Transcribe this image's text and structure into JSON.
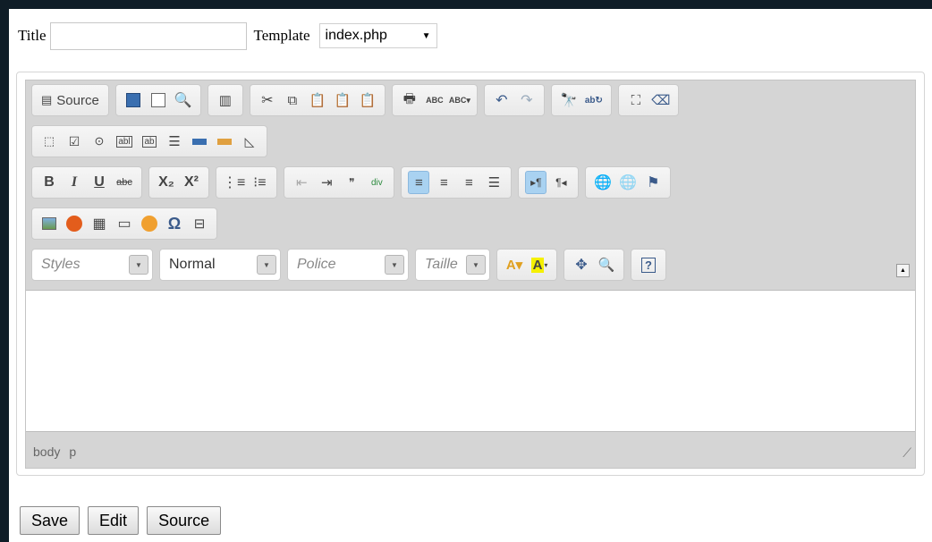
{
  "form": {
    "title_label": "Title",
    "title_value": "",
    "template_label": "Template",
    "template_selected": "index.php"
  },
  "toolbar": {
    "source_label": "Source",
    "row1_icons": [
      "source-icon",
      "save-icon",
      "new-page-icon",
      "preview-icon",
      "templates-icon",
      "cut-icon",
      "copy-icon",
      "paste-icon",
      "paste-text-icon",
      "paste-word-icon",
      "print-icon",
      "spellcheck-icon",
      "spellcheck-as-you-type-icon",
      "undo-icon",
      "redo-icon",
      "find-icon",
      "replace-icon",
      "select-all-icon",
      "remove-format-icon"
    ],
    "row2_icons": [
      "form-icon",
      "checkbox-icon",
      "radio-icon",
      "textfield-icon",
      "textarea-icon",
      "select-icon",
      "button-icon",
      "image-button-icon",
      "hidden-field-icon"
    ],
    "text_glyphs": {
      "bold": "B",
      "italic": "I",
      "underline": "U",
      "strike": "abc",
      "subscript": "X₂",
      "superscript": "X²",
      "quote": "❞"
    },
    "combos": {
      "styles": "Styles",
      "format": "Normal",
      "font": "Police",
      "size": "Taillе"
    }
  },
  "status": {
    "path": [
      "body",
      "p"
    ]
  },
  "buttons": {
    "save": "Save",
    "edit": "Edit",
    "source": "Source"
  },
  "colors": {
    "background": "#0f1d27",
    "active_button": "#a9d2f1",
    "toolbar": "#d5d5d5"
  }
}
